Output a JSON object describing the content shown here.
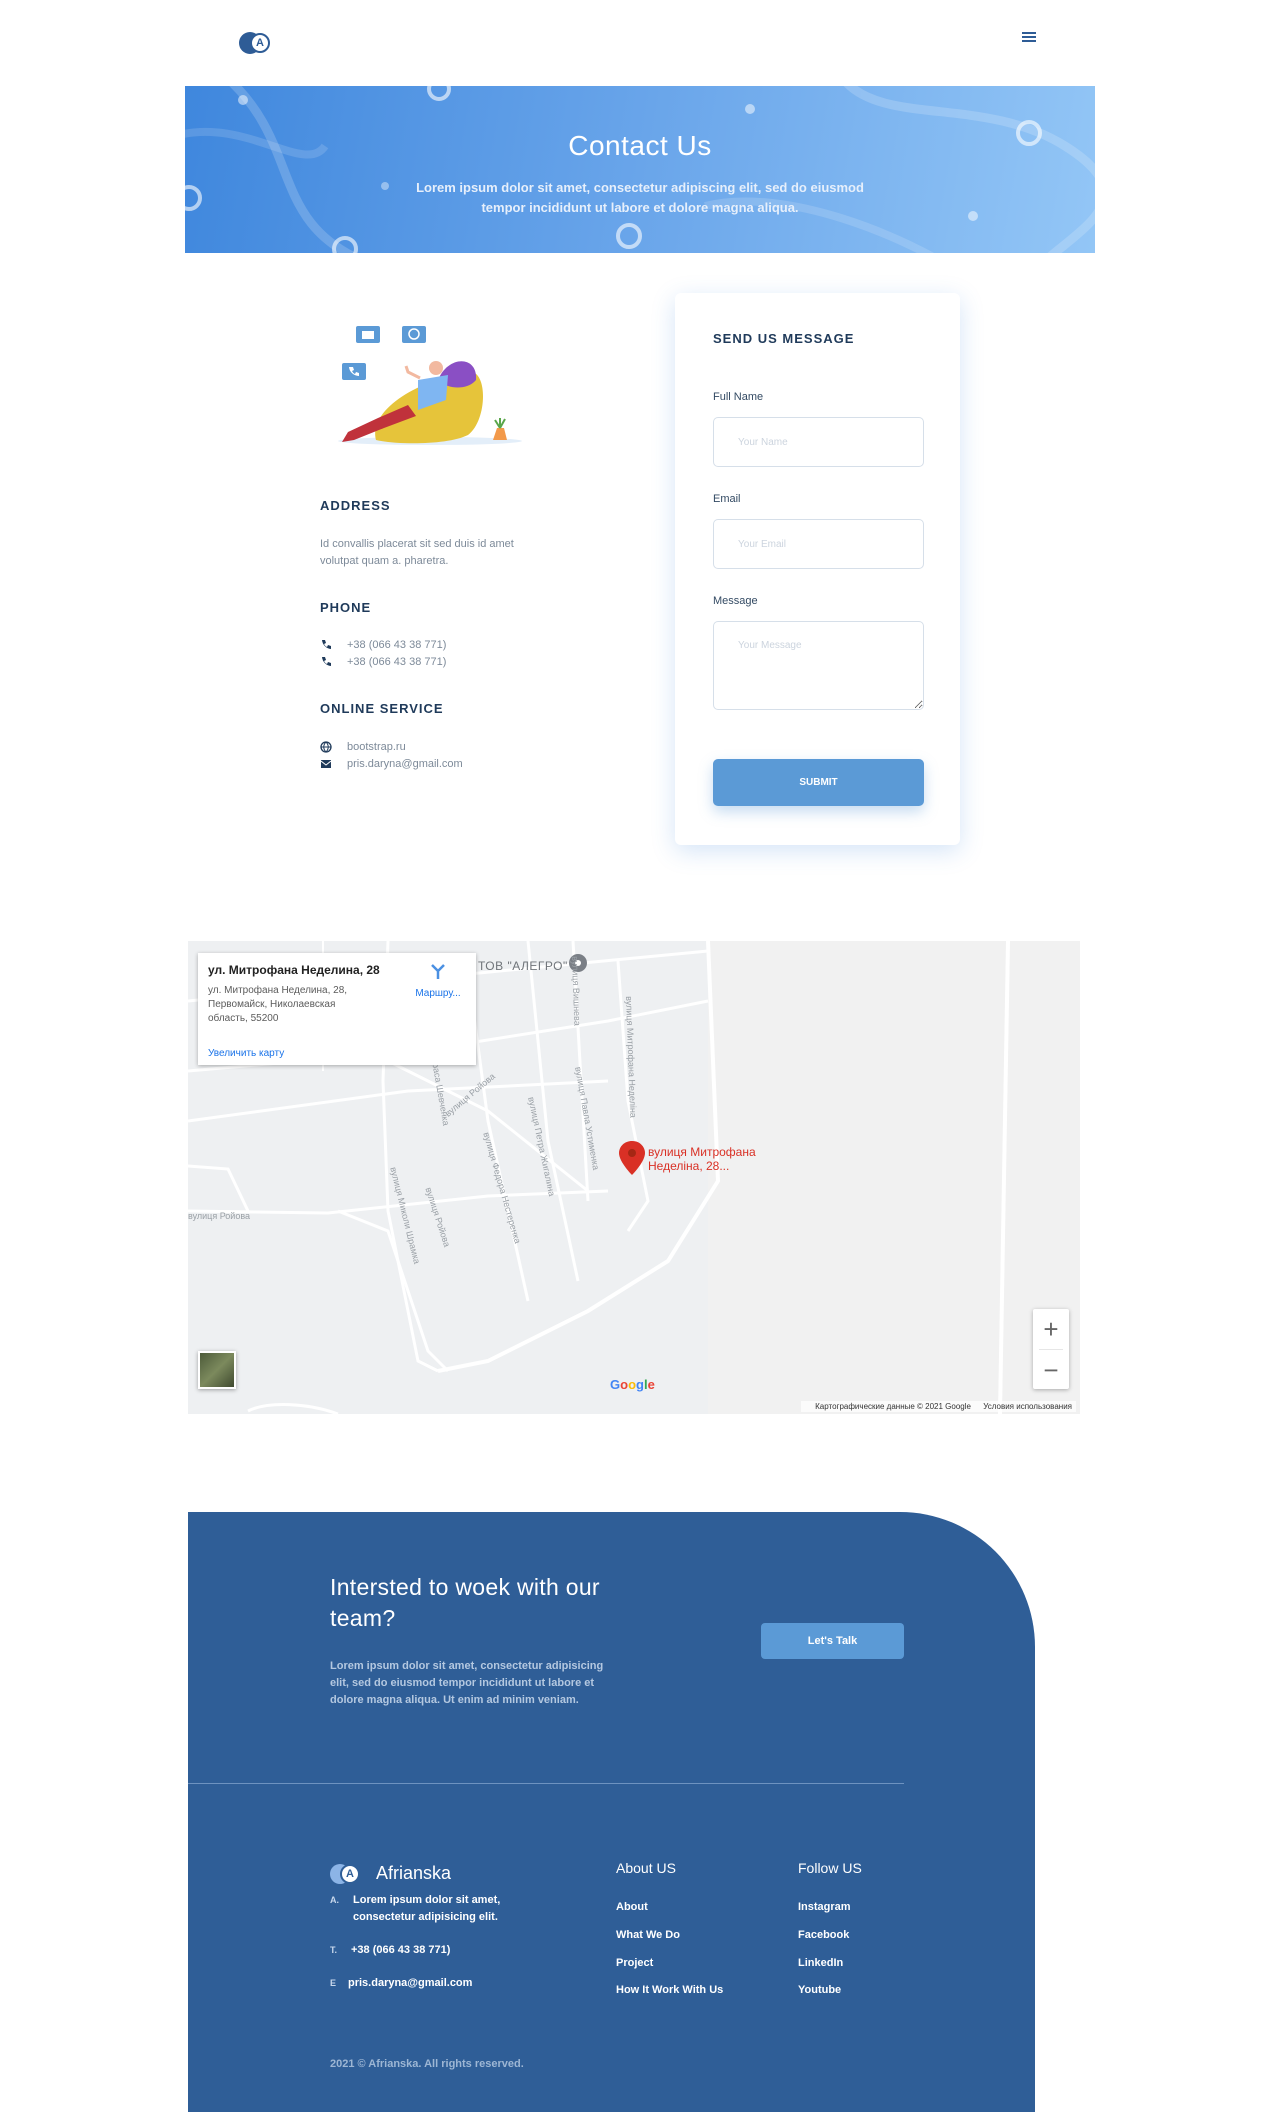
{
  "header": {
    "logo_letter": "A",
    "menu_icon": "hamburger-menu-icon"
  },
  "hero": {
    "title": "Contact Us",
    "subtitle": "Lorem ipsum dolor sit amet, consectetur adipiscing elit, sed do eiusmod tempor incididunt ut labore et dolore magna aliqua."
  },
  "contact_info": {
    "address_heading": "ADDRESS",
    "address_text": "Id convallis placerat sit sed duis id amet volutpat quam a. pharetra.",
    "phone_heading": "PHONE",
    "phones": [
      "+38 (066 43 38 771)",
      "+38 (066 43 38 771)"
    ],
    "online_heading": "ONLINE SERVICE",
    "website": "bootstrap.ru",
    "email": "pris.daryna@gmail.com"
  },
  "form": {
    "title": "SEND US MESSAGE",
    "full_name_label": "Full Name",
    "full_name_placeholder": "Your Name",
    "email_label": "Email",
    "email_placeholder": "Your Email",
    "message_label": "Message",
    "message_placeholder": "Your Message",
    "submit_label": "SUBMIT"
  },
  "map": {
    "card_title": "ул. Митрофана Неделина, 28",
    "card_address": "ул. Митрофана Неделина, 28, Первомайск, Николаевская область, 55200",
    "enlarge_link": "Увеличить карту",
    "directions_label": "Маршру...",
    "poi_label": "ТОВ \"АЛЕГРО\"",
    "pin_label": "вулиця Митрофана Неделіна, 28...",
    "streets": [
      "вулиця Ройова",
      "вулиця Ройова",
      "вулиця Тараса Шевченка",
      "вулиця Вишнева",
      "вулиця Павла Устименка",
      "вулиця Петра Жигалина",
      "вулиця Федора Нестеренка",
      "вулиця Митрофана Неделіна",
      "вулиця Миколи Шрамка",
      "вулиця Ройова"
    ],
    "zoom_in": "+",
    "zoom_out": "−",
    "google": "Google",
    "map_data": "Картографические данные © 2021 Google",
    "terms": "Условия использования"
  },
  "footer": {
    "cta_title": "Intersted to woek with our team?",
    "cta_text": "Lorem ipsum dolor sit amet, consectetur adipisicing elit, sed do eiusmod tempor incididunt ut labore et dolore magna aliqua. Ut enim ad minim veniam.",
    "cta_button": "Let's Talk",
    "brand_name": "Afrianska",
    "brand_letter": "A",
    "address_key": "A.",
    "address_val": "Lorem ipsum dolor sit amet, consectetur adipisicing elit.",
    "phone_key": "T.",
    "phone_val": "+38 (066 43 38 771)",
    "email_key": "E",
    "email_val": "pris.daryna@gmail.com",
    "about_heading": "About US",
    "about_links": [
      "About",
      "What We Do",
      "Project",
      "How It Work With Us"
    ],
    "follow_heading": "Follow US",
    "follow_links": [
      "Instagram",
      "Facebook",
      "LinkedIn",
      "Youtube"
    ],
    "copyright": "2021 © Afrianska. All rights reserved."
  },
  "colors": {
    "primary": "#2f5e97",
    "accent": "#5b9ad6",
    "hero_start": "#3f87dd",
    "hero_end": "#93c6f6",
    "pin": "#d93025"
  }
}
